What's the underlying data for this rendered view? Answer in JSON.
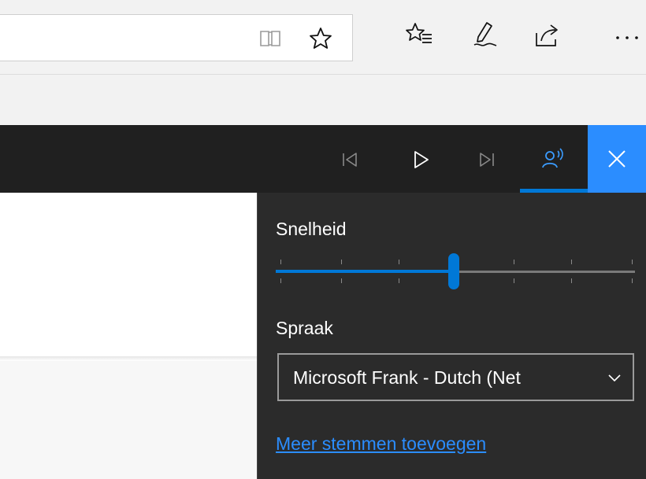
{
  "toolbar": {
    "icons": [
      "reading-view-icon",
      "favorite-star-icon",
      "favorites-list-icon",
      "web-note-icon",
      "share-icon",
      "more-icon"
    ]
  },
  "read_aloud_bar": {
    "icons": [
      "previous-icon",
      "play-icon",
      "next-icon",
      "voice-settings-icon",
      "close-icon"
    ],
    "accent_color": "#0078d7",
    "close_bg_color": "#2b8dff"
  },
  "voice_settings": {
    "speed_label": "Snelheid",
    "speed_level": 0.5,
    "voice_label": "Spraak",
    "voice_value": "Microsoft Frank - Dutch (Net",
    "more_voices_link": "Meer stemmen toevoegen"
  }
}
